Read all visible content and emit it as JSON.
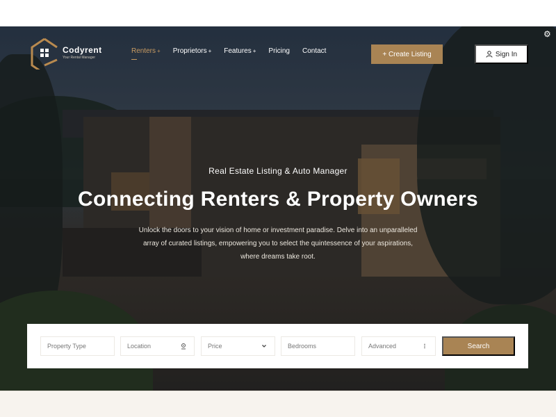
{
  "brand": {
    "name": "Codyrent",
    "tagline": "Your Rental Manager"
  },
  "nav": {
    "items": [
      {
        "label": "Renters",
        "suffix": "+"
      },
      {
        "label": "Proprietors",
        "suffix": "+"
      },
      {
        "label": "Features",
        "suffix": "+"
      },
      {
        "label": "Pricing",
        "suffix": ""
      },
      {
        "label": "Contact",
        "suffix": ""
      }
    ],
    "create_listing": "+ Create Listing",
    "sign_in": "Sign In"
  },
  "hero": {
    "eyebrow": "Real Estate Listing & Auto Manager",
    "headline": "Connecting Renters & Property Owners",
    "subtext": "Unlock the doors to your vision of home or investment paradise. Delve into an unparalleled array of curated listings, empowering you to select the quintessence of your aspirations, where dreams take root."
  },
  "search": {
    "property_type": "Property Type",
    "location": "Location",
    "price": "Price",
    "bedrooms": "Bedrooms",
    "advanced": "Advanced",
    "button": "Search"
  },
  "colors": {
    "accent": "#a98454",
    "active_nav": "#c89b62"
  },
  "icons": [
    "logo-house-icon",
    "user-icon",
    "location-pin-icon",
    "chevron-down-icon",
    "more-vertical-icon",
    "settings-gear-icon"
  ]
}
